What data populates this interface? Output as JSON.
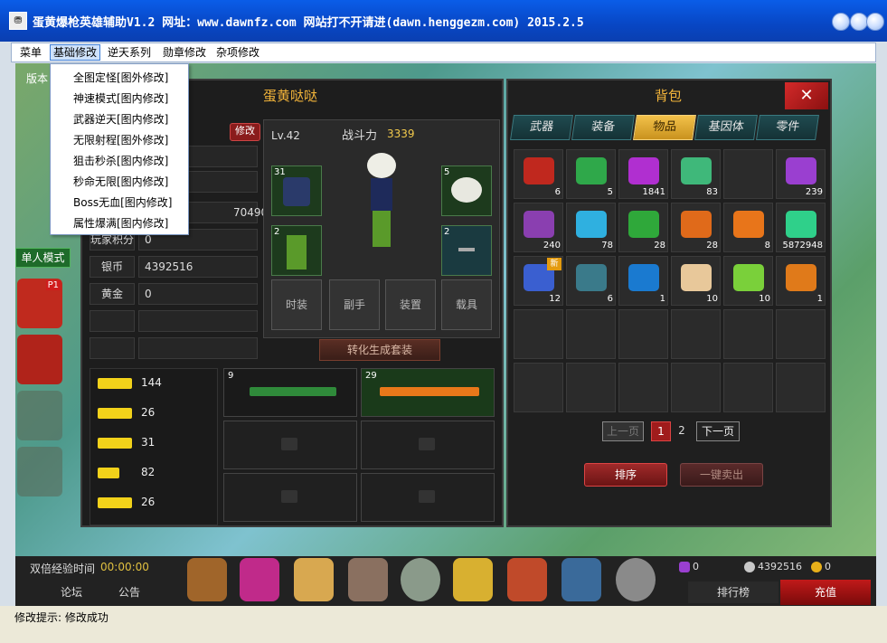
{
  "window": {
    "title": "蛋黄爆枪英雄辅助V1.2 网址：www.dawnfz.com 网站打不开请进(dawn.henggezm.com) 2015.2.5",
    "icon": "app-icon"
  },
  "menu": [
    {
      "label": "菜单"
    },
    {
      "label": "基础修改",
      "active": true
    },
    {
      "label": "逆天系列"
    },
    {
      "label": "勋章修改"
    },
    {
      "label": "杂项修改"
    }
  ],
  "dropdown": [
    "全图定怪[图外修改]",
    "神速模式[图内修改]",
    "武器逆天[图内修改]",
    "无限射程[图外修改]",
    "狙击秒杀[图内修改]",
    "秒命无限[图内修改]",
    "Boss无血[图内修改]",
    "属性爆满[图内修改]"
  ],
  "game": {
    "version_label": "版本",
    "mode_button": "单人模式",
    "player_badge": "P1",
    "left_panel": {
      "title": "蛋黄哒哒",
      "edit_button": "修改",
      "partial_value": "704900",
      "rows": [
        {
          "label": "玩家积分",
          "value": "0"
        },
        {
          "label": "银币",
          "value": "4392516"
        },
        {
          "label": "黄金",
          "value": "0"
        }
      ],
      "level": "Lv.42",
      "power_label": "战斗力",
      "power_value": "3339",
      "slots": [
        {
          "num": "31",
          "icon": "jacket-icon"
        },
        {
          "num": "5",
          "icon": "hair-icon"
        },
        {
          "num": "2",
          "icon": "pants-icon"
        },
        {
          "num": "2",
          "icon": "accessory-icon"
        }
      ],
      "equip_buttons": [
        "时装",
        "副手",
        "装置",
        "载具"
      ],
      "convert_button": "转化生成套装",
      "weapons": [
        {
          "value": "144",
          "icon": "rifle-icon"
        },
        {
          "value": "26",
          "icon": "sniper-icon"
        },
        {
          "value": "31",
          "icon": "shotgun-icon"
        },
        {
          "value": "82",
          "icon": "pistol-icon"
        },
        {
          "value": "26",
          "icon": "heavy-gun-icon"
        }
      ],
      "gun_slots": [
        {
          "num": "9",
          "icon": "green-rifle-icon"
        },
        {
          "num": "29",
          "icon": "orange-rifle-icon"
        }
      ]
    },
    "bag": {
      "title": "背包",
      "close": "✕",
      "tabs": [
        "武器",
        "装备",
        "物品",
        "基因体",
        "零件"
      ],
      "active_tab": 2,
      "items": [
        {
          "count": "6",
          "icon": "potion-icon",
          "color": "#c0281e"
        },
        {
          "count": "5",
          "icon": "green-box-icon",
          "color": "#2fa84a"
        },
        {
          "count": "1841",
          "icon": "purple-gem-icon",
          "color": "#b02fd0"
        },
        {
          "count": "83",
          "icon": "green-card-icon",
          "color": "#3fb87a"
        },
        {
          "count": "",
          "icon": "empty",
          "color": ""
        },
        {
          "count": "239",
          "icon": "purple-chest-icon",
          "color": "#9a3fd0"
        },
        {
          "count": "240",
          "icon": "purple-box-icon",
          "color": "#8a3fb0"
        },
        {
          "count": "78",
          "icon": "exp-card-icon",
          "color": "#2fb0e0"
        },
        {
          "count": "28",
          "icon": "r-card-icon",
          "color": "#2fa83a"
        },
        {
          "count": "28",
          "icon": "orange-ticket-icon",
          "color": "#e06a1a"
        },
        {
          "count": "8",
          "icon": "orange-gem-icon",
          "color": "#e8751a"
        },
        {
          "count": "5872948",
          "icon": "green-gem-icon",
          "color": "#2fd08a"
        },
        {
          "count": "12",
          "icon": "blue-chest-icon",
          "color": "#3a5fd0",
          "new": "新"
        },
        {
          "count": "6",
          "icon": "steel-box-icon",
          "color": "#3a7a8a"
        },
        {
          "count": "1",
          "icon": "blue-card-icon",
          "color": "#1a7ad0"
        },
        {
          "count": "10",
          "icon": "scroll-icon",
          "color": "#e8c89a"
        },
        {
          "count": "10",
          "icon": "tube-icon",
          "color": "#7ad03a"
        },
        {
          "count": "1",
          "icon": "orange-flask-icon",
          "color": "#e07a1a"
        }
      ],
      "prev_page": "上一页",
      "pages": [
        "1",
        "2"
      ],
      "next_page": "下一页",
      "sort_button": "排序",
      "sell_button": "一键卖出"
    },
    "bottom": {
      "double_exp_label": "双倍经验时间",
      "double_exp_time": "00:00:00",
      "forum": "论坛",
      "notice": "公告",
      "leaderboard": "排行榜",
      "recharge": "充值",
      "currency": [
        "0",
        "4392516",
        "0"
      ]
    }
  },
  "status": {
    "label": "修改提示:",
    "message": "修改成功"
  },
  "colors": {
    "title_bar": "#0846c4",
    "accent": "#f2b43a"
  }
}
